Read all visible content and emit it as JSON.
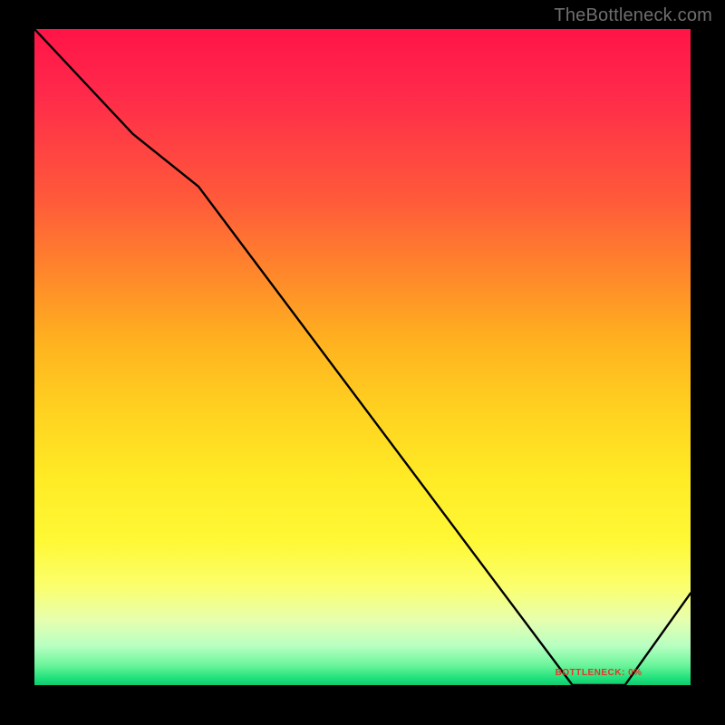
{
  "watermark": "TheBottleneck.com",
  "chart_data": {
    "type": "line",
    "title": "",
    "xlabel": "",
    "ylabel": "",
    "x": [
      0,
      15,
      25,
      82,
      90,
      100
    ],
    "values": [
      100,
      84,
      76,
      0,
      0,
      14
    ],
    "xlim": [
      0,
      100
    ],
    "ylim": [
      0,
      100
    ],
    "grid": false,
    "annotations": [
      {
        "text": "BOTTLENECK: 0%",
        "x": 86,
        "y": 1
      }
    ],
    "background_gradient_stops": [
      {
        "pct": 0,
        "color": "#ff1448"
      },
      {
        "pct": 50,
        "color": "#ffd120"
      },
      {
        "pct": 85,
        "color": "#fbff6e"
      },
      {
        "pct": 100,
        "color": "#11c970"
      }
    ]
  }
}
